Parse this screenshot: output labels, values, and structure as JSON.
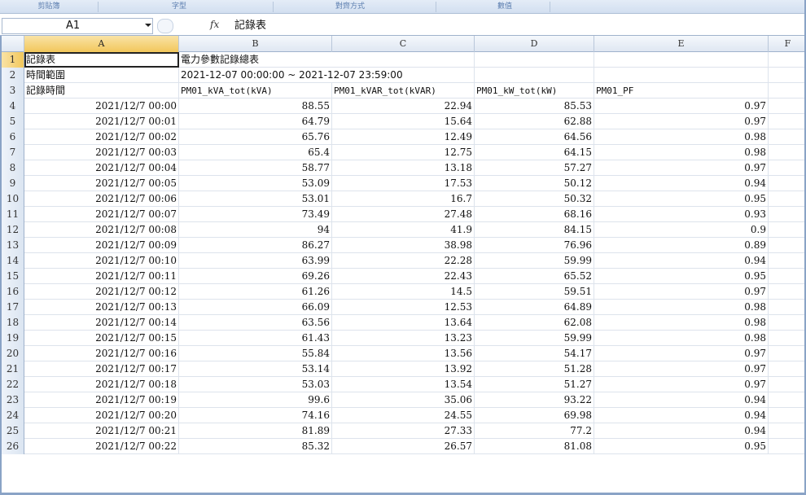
{
  "ribbon": {
    "groups": [
      "剪貼簿",
      "字型",
      "對齊方式",
      "數值"
    ]
  },
  "formula_bar": {
    "name_box": "A1",
    "fx_label": "fx",
    "content": "記錄表"
  },
  "columns": [
    "A",
    "B",
    "C",
    "D",
    "E",
    "F"
  ],
  "header_rows": [
    {
      "num": "1",
      "A": "記錄表",
      "B": "電力參數記錄總表"
    },
    {
      "num": "2",
      "A": "時間範圍",
      "B": "2021-12-07 00:00:00 ~ 2021-12-07 23:59:00"
    },
    {
      "num": "3",
      "A": "記錄時間",
      "B": "PM01_kVA_tot(kVA)",
      "C": "PM01_kVAR_tot(kVAR)",
      "D": "PM01_kW_tot(kW)",
      "E": "PM01_PF"
    }
  ],
  "data_rows": [
    {
      "num": "4",
      "A": "2021/12/7 00:00",
      "B": "88.55",
      "C": "22.94",
      "D": "85.53",
      "E": "0.97"
    },
    {
      "num": "5",
      "A": "2021/12/7 00:01",
      "B": "64.79",
      "C": "15.64",
      "D": "62.88",
      "E": "0.97"
    },
    {
      "num": "6",
      "A": "2021/12/7 00:02",
      "B": "65.76",
      "C": "12.49",
      "D": "64.56",
      "E": "0.98"
    },
    {
      "num": "7",
      "A": "2021/12/7 00:03",
      "B": "65.4",
      "C": "12.75",
      "D": "64.15",
      "E": "0.98"
    },
    {
      "num": "8",
      "A": "2021/12/7 00:04",
      "B": "58.77",
      "C": "13.18",
      "D": "57.27",
      "E": "0.97"
    },
    {
      "num": "9",
      "A": "2021/12/7 00:05",
      "B": "53.09",
      "C": "17.53",
      "D": "50.12",
      "E": "0.94"
    },
    {
      "num": "10",
      "A": "2021/12/7 00:06",
      "B": "53.01",
      "C": "16.7",
      "D": "50.32",
      "E": "0.95"
    },
    {
      "num": "11",
      "A": "2021/12/7 00:07",
      "B": "73.49",
      "C": "27.48",
      "D": "68.16",
      "E": "0.93"
    },
    {
      "num": "12",
      "A": "2021/12/7 00:08",
      "B": "94",
      "C": "41.9",
      "D": "84.15",
      "E": "0.9"
    },
    {
      "num": "13",
      "A": "2021/12/7 00:09",
      "B": "86.27",
      "C": "38.98",
      "D": "76.96",
      "E": "0.89"
    },
    {
      "num": "14",
      "A": "2021/12/7 00:10",
      "B": "63.99",
      "C": "22.28",
      "D": "59.99",
      "E": "0.94"
    },
    {
      "num": "15",
      "A": "2021/12/7 00:11",
      "B": "69.26",
      "C": "22.43",
      "D": "65.52",
      "E": "0.95"
    },
    {
      "num": "16",
      "A": "2021/12/7 00:12",
      "B": "61.26",
      "C": "14.5",
      "D": "59.51",
      "E": "0.97"
    },
    {
      "num": "17",
      "A": "2021/12/7 00:13",
      "B": "66.09",
      "C": "12.53",
      "D": "64.89",
      "E": "0.98"
    },
    {
      "num": "18",
      "A": "2021/12/7 00:14",
      "B": "63.56",
      "C": "13.64",
      "D": "62.08",
      "E": "0.98"
    },
    {
      "num": "19",
      "A": "2021/12/7 00:15",
      "B": "61.43",
      "C": "13.23",
      "D": "59.99",
      "E": "0.98"
    },
    {
      "num": "20",
      "A": "2021/12/7 00:16",
      "B": "55.84",
      "C": "13.56",
      "D": "54.17",
      "E": "0.97"
    },
    {
      "num": "21",
      "A": "2021/12/7 00:17",
      "B": "53.14",
      "C": "13.92",
      "D": "51.28",
      "E": "0.97"
    },
    {
      "num": "22",
      "A": "2021/12/7 00:18",
      "B": "53.03",
      "C": "13.54",
      "D": "51.27",
      "E": "0.97"
    },
    {
      "num": "23",
      "A": "2021/12/7 00:19",
      "B": "99.6",
      "C": "35.06",
      "D": "93.22",
      "E": "0.94"
    },
    {
      "num": "24",
      "A": "2021/12/7 00:20",
      "B": "74.16",
      "C": "24.55",
      "D": "69.98",
      "E": "0.94"
    },
    {
      "num": "25",
      "A": "2021/12/7 00:21",
      "B": "81.89",
      "C": "27.33",
      "D": "77.2",
      "E": "0.94"
    },
    {
      "num": "26",
      "A": "2021/12/7 00:22",
      "B": "85.32",
      "C": "26.57",
      "D": "81.08",
      "E": "0.95"
    }
  ]
}
